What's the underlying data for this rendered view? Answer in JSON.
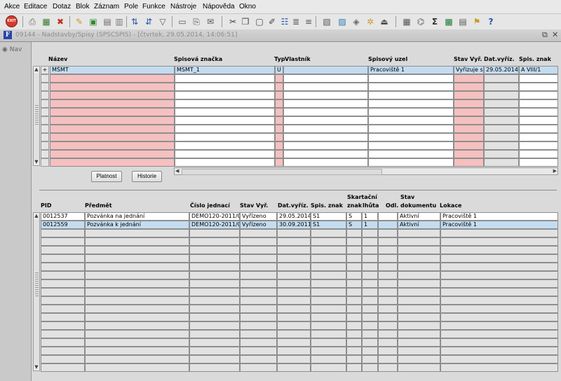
{
  "menu": [
    "Akce",
    "Editace",
    "Dotaz",
    "Blok",
    "Záznam",
    "Pole",
    "Funkce",
    "Nástroje",
    "Nápověda",
    "Okno"
  ],
  "toolbar": {
    "exit_label": "EXIT",
    "icons": [
      "save-icon",
      "print-icon",
      "delete-icon",
      "open-folder-icon",
      "clear-icon",
      "new-icon",
      "sort-icon",
      "sort-desc-icon",
      "filter-icon",
      "print-preview-icon",
      "attach-icon",
      "mail-icon",
      "cut-icon",
      "copy-icon",
      "paste-icon",
      "edit-icon",
      "list-icon",
      "indent-icon",
      "report-icon",
      "export-icon",
      "settings-icon",
      "bug-icon",
      "hat-icon",
      "chart-icon",
      "link-icon",
      "sum-icon",
      "excel-icon",
      "document-icon",
      "help-icon",
      "question-icon"
    ]
  },
  "window": {
    "title": "09144 - Nadstavby/Spisy (SPSCSPIS) - [čtvrtek, 29.05.2014, 14:06:51]"
  },
  "nav": {
    "label": "Nav"
  },
  "top_table": {
    "headers": {
      "nazev": "Název",
      "spisova_znacka": "Spisová značka",
      "typ": "Typ",
      "vlastnik": "Vlastník",
      "spisovy_uzel": "Spisový uzel",
      "stav": "Stav Vyř.",
      "datum": "Dat.vyříz.",
      "spis_znak": "Spis. znak"
    },
    "row": {
      "marker": "+",
      "nazev": "MŠMT",
      "spisova_znacka": "MSMT_1",
      "typ": "U",
      "vlastnik": "",
      "spisovy_uzel": "Pracoviště 1",
      "stav": "Vyřizuje s",
      "datum": "29.05.2014",
      "spis_znak": "A VIII/1"
    }
  },
  "buttons": {
    "platnost": "Platnost",
    "historie": "Historie"
  },
  "bottom_table": {
    "headers": {
      "pid": "PID",
      "predmet": "Předmět",
      "cislo_jednaci": "Číslo jednací",
      "stav_vyr": "Stav Vyř.",
      "dat_vyriz": "Dat.vyříz.",
      "spis_znak": "Spis. znak",
      "skartacni_line1": "Skartační",
      "skartacni_znak": "znak",
      "skartacni_lhuta": "lhůta",
      "odl": "Odl.",
      "stav_dok_line1": "Stav",
      "stav_dok_line2": "dokumentu",
      "lokace": "Lokace"
    },
    "rows": [
      {
        "pid": "0012537",
        "predmet": "Pozvánka na jednání",
        "cislo_jednaci": "DEMO120-2011/0(",
        "stav_vyr": "Vyřízeno",
        "dat_vyriz": "29.05.2014",
        "spis_znak": "S1",
        "skart_znak": "S",
        "skart_lhuta": "1",
        "odl": "",
        "stav_dok": "Aktivní",
        "lokace": "Pracoviště 1"
      },
      {
        "pid": "0012559",
        "predmet": "Pozvánka k jednání",
        "cislo_jednaci": "DEMO120-2011/0(",
        "stav_vyr": "Vyřízeno",
        "dat_vyriz": "30.09.2011",
        "spis_znak": "S1",
        "skart_znak": "S",
        "skart_lhuta": "1",
        "odl": "",
        "stav_dok": "Aktivní",
        "lokace": "Pracoviště 1"
      }
    ]
  },
  "colors": {
    "required_cell": "#f5c0c0",
    "selected_row": "#c4dcf0",
    "window_icon": "#2a47a8",
    "exit_button": "#d63b2b"
  }
}
